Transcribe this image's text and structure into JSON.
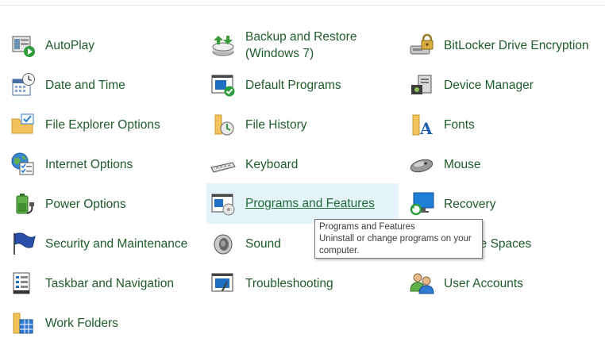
{
  "items": [
    {
      "label": "AutoPlay",
      "icon": "autoplay-icon"
    },
    {
      "label": "Backup and Restore\n(Windows 7)",
      "icon": "backup-restore-icon"
    },
    {
      "label": "BitLocker Drive Encryption",
      "icon": "bitlocker-icon"
    },
    {
      "label": "Date and Time",
      "icon": "date-time-icon"
    },
    {
      "label": "Default Programs",
      "icon": "default-programs-icon"
    },
    {
      "label": "Device Manager",
      "icon": "device-manager-icon"
    },
    {
      "label": "File Explorer Options",
      "icon": "folder-options-icon"
    },
    {
      "label": "File History",
      "icon": "file-history-icon"
    },
    {
      "label": "Fonts",
      "icon": "fonts-icon"
    },
    {
      "label": "Internet Options",
      "icon": "internet-options-icon"
    },
    {
      "label": "Keyboard",
      "icon": "keyboard-icon"
    },
    {
      "label": "Mouse",
      "icon": "mouse-icon"
    },
    {
      "label": "Power Options",
      "icon": "power-options-icon"
    },
    {
      "label": "Programs and Features",
      "icon": "programs-features-icon"
    },
    {
      "label": "Recovery",
      "icon": "recovery-icon"
    },
    {
      "label": "Security and Maintenance",
      "icon": "security-maintenance-icon"
    },
    {
      "label": "Sound",
      "icon": "sound-icon"
    },
    {
      "label": "Storage Spaces",
      "icon": "storage-spaces-icon"
    },
    {
      "label": "Taskbar and Navigation",
      "icon": "taskbar-icon"
    },
    {
      "label": "Troubleshooting",
      "icon": "troubleshooting-icon"
    },
    {
      "label": "User Accounts",
      "icon": "user-accounts-icon"
    },
    {
      "label": "Work Folders",
      "icon": "work-folders-icon"
    }
  ],
  "tooltip": {
    "title": "Programs and Features",
    "text": "Uninstall or change programs on your computer."
  },
  "colors": {
    "link": "#1e5b2a",
    "hover_bg": "#e5f3fb"
  }
}
